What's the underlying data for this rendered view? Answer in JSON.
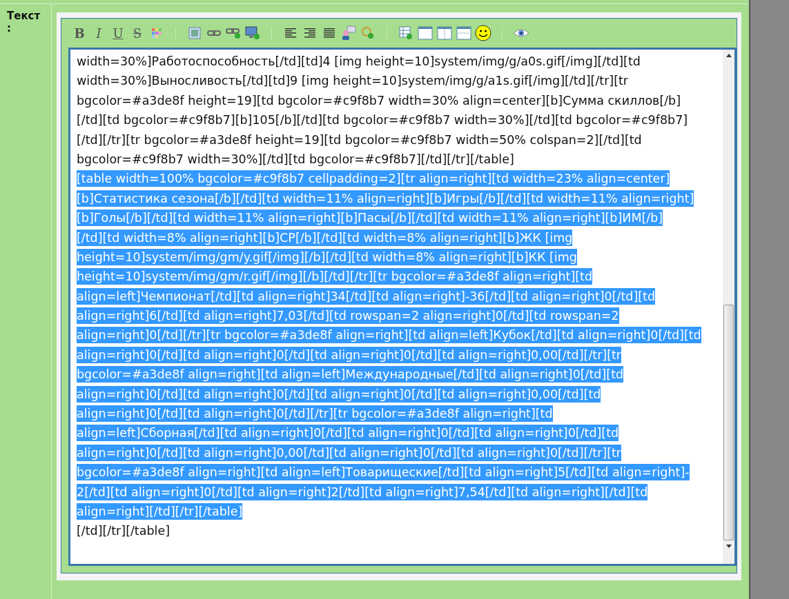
{
  "field_label": "Текст :",
  "toolbar": [
    [
      {
        "kind": "bold",
        "label": "B"
      },
      {
        "kind": "italic",
        "label": "I"
      },
      {
        "kind": "underline",
        "label": "U"
      },
      {
        "kind": "strike",
        "label": "S"
      },
      {
        "kind": "palette"
      }
    ],
    [
      {
        "kind": "image"
      },
      {
        "kind": "link"
      },
      {
        "kind": "link-add"
      },
      {
        "kind": "monitor-add"
      }
    ],
    [
      {
        "kind": "align-left"
      },
      {
        "kind": "align-right"
      },
      {
        "kind": "justify"
      },
      {
        "kind": "user-comment"
      },
      {
        "kind": "zoom-add"
      }
    ],
    [
      {
        "kind": "table-add"
      },
      {
        "kind": "window"
      },
      {
        "kind": "columns"
      },
      {
        "kind": "rule"
      },
      {
        "kind": "smiley"
      }
    ],
    [
      {
        "kind": "eye"
      }
    ]
  ],
  "editor": {
    "lines": [
      {
        "text": "width=30%]Работоспособность[/td][td]4 [img height=10]system/img/g/a0s.gif[/img][/td][td",
        "selected": false
      },
      {
        "text": "width=30%]Выносливость[/td][td]9 [img height=10]system/img/g/a1s.gif[/img][/td][/tr][tr",
        "selected": false
      },
      {
        "text": "bgcolor=#a3de8f height=19][td bgcolor=#c9f8b7 width=30% align=center][b]Сумма скиллов[/b]",
        "selected": false
      },
      {
        "text": "[/td][td bgcolor=#c9f8b7][b]105[/b][/td][td bgcolor=#c9f8b7 width=30%][/td][td bgcolor=#c9f8b7]",
        "selected": false
      },
      {
        "text": "[/td][/tr][tr bgcolor=#a3de8f height=19][td bgcolor=#c9f8b7 width=50% colspan=2][/td][td",
        "selected": false
      },
      {
        "text": "bgcolor=#c9f8b7 width=30%][/td][td bgcolor=#c9f8b7][/td][/tr][/table]",
        "selected": false
      },
      {
        "text": "[table width=100% bgcolor=#c9f8b7 cellpadding=2][tr align=right][td width=23% align=center]",
        "selected": true
      },
      {
        "text": "[b]Статистика сезона[/b][/td][td width=11% align=right][b]Игры[/b][/td][td width=11% align=right]",
        "selected": true
      },
      {
        "text": "[b]Голы[/b][/td][td width=11% align=right][b]Пасы[/b][/td][td width=11% align=right][b]ИМ[/b]",
        "selected": true
      },
      {
        "text": "[/td][td width=8% align=right][b]СР[/b][/td][td width=8% align=right][b]ЖК [img",
        "selected": true
      },
      {
        "text": "height=10]system/img/gm/y.gif[/img][/b][/td][td width=8% align=right][b]КК [img",
        "selected": true
      },
      {
        "text": "height=10]system/img/gm/r.gif[/img][/b][/td][/tr][tr bgcolor=#a3de8f align=right][td",
        "selected": true
      },
      {
        "text": "align=left]Чемпионат[/td][td align=right]34[/td][td align=right]-36[/td][td align=right]0[/td][td",
        "selected": true
      },
      {
        "text": "align=right]6[/td][td align=right]7,03[/td][td rowspan=2 align=right]0[/td][td rowspan=2",
        "selected": true
      },
      {
        "text": "align=right]0[/td][/tr][tr bgcolor=#a3de8f align=right][td align=left]Кубок[/td][td align=right]0[/td][td",
        "selected": true
      },
      {
        "text": "align=right]0[/td][td align=right]0[/td][td align=right]0[/td][td align=right]0,00[/td][/tr][tr",
        "selected": true
      },
      {
        "text": "bgcolor=#a3de8f align=right][td align=left]Международные[/td][td align=right]0[/td][td",
        "selected": true
      },
      {
        "text": "align=right]0[/td][td align=right]0[/td][td align=right]0[/td][td align=right]0,00[/td][td",
        "selected": true
      },
      {
        "text": "align=right]0[/td][td align=right]0[/td][/tr][tr bgcolor=#a3de8f align=right][td",
        "selected": true
      },
      {
        "text": "align=left]Сборная[/td][td align=right]0[/td][td align=right]0[/td][td align=right]0[/td][td",
        "selected": true
      },
      {
        "text": "align=right]0[/td][td align=right]0,00[/td][td align=right]0[/td][td align=right]0[/td][/tr][tr",
        "selected": true
      },
      {
        "text": "bgcolor=#a3de8f align=right][td align=left]Товарищеские[/td][td align=right]5[/td][td align=right]-",
        "selected": true
      },
      {
        "text": "2[/td][td align=right]0[/td][td align=right]2[/td][td align=right]7,54[/td][td align=right][/td][td",
        "selected": true
      },
      {
        "text": "align=right][/td][/tr][/table]",
        "selected": true
      },
      {
        "text": "[/td][/tr][/table]",
        "selected": false
      }
    ]
  }
}
